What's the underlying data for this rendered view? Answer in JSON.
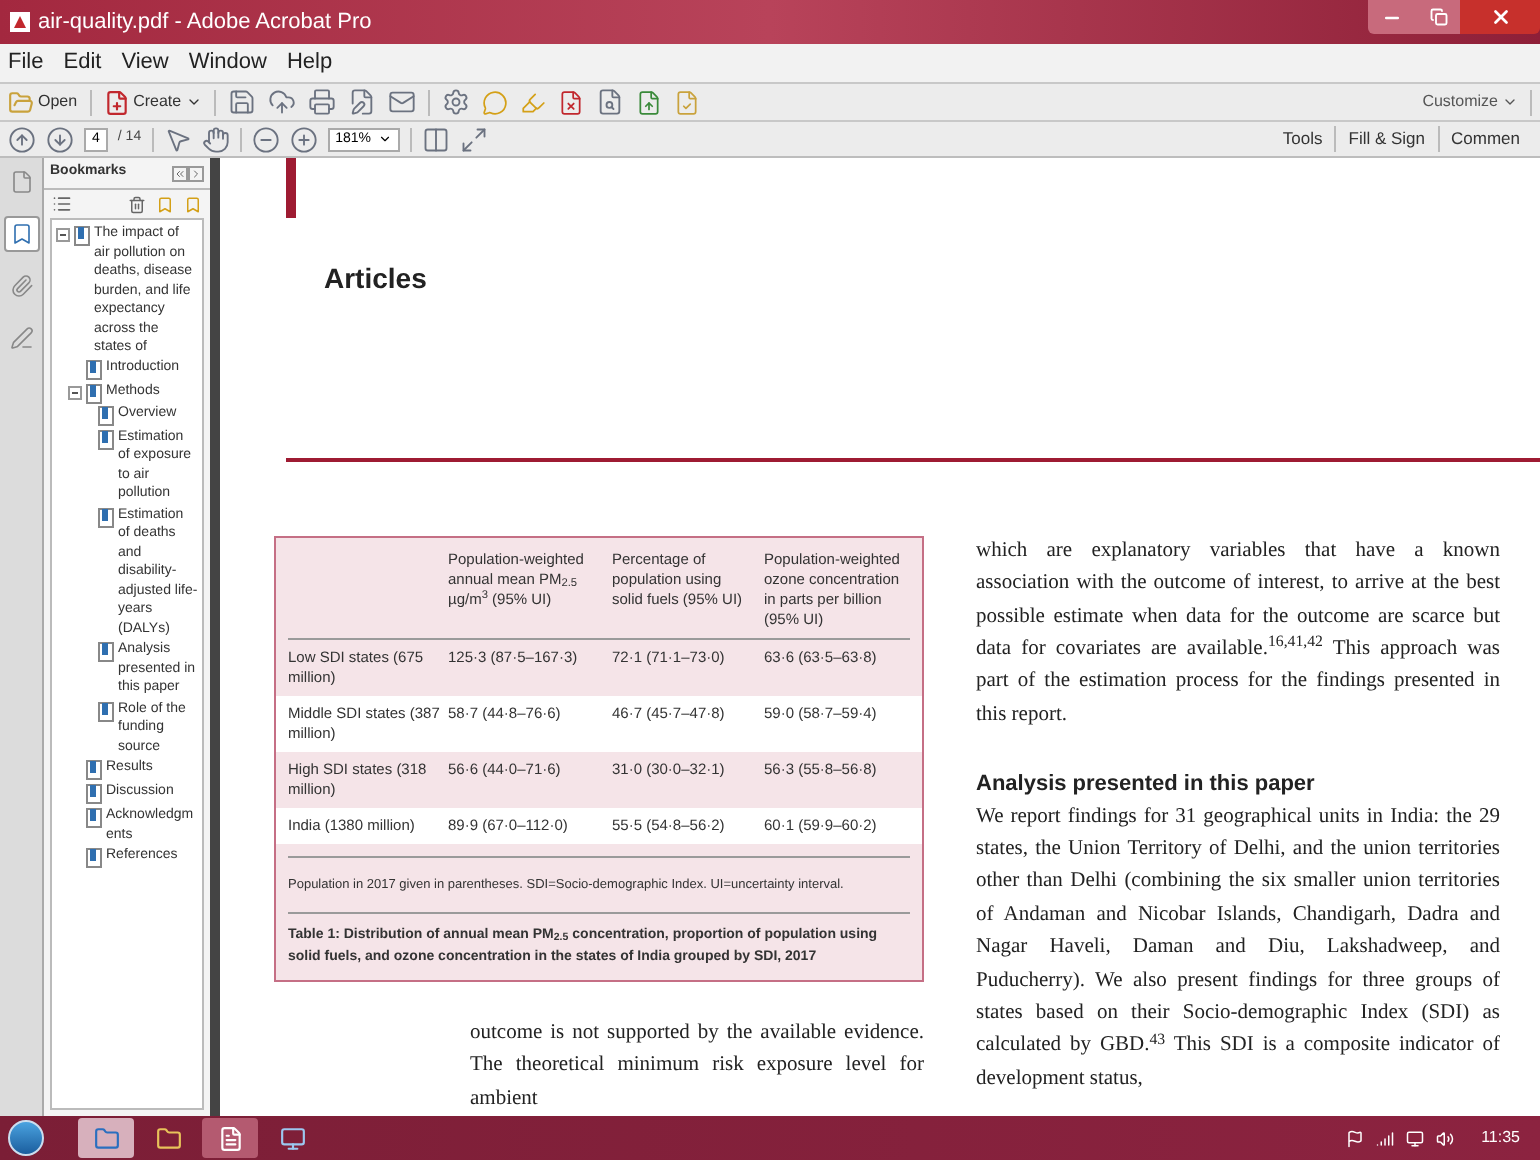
{
  "window": {
    "title": "air-quality.pdf - Adobe Acrobat Pro"
  },
  "menu": [
    "File",
    "Edit",
    "View",
    "Window",
    "Help"
  ],
  "toolbar": {
    "open": "Open",
    "create": "Create",
    "customize": "Customize"
  },
  "nav": {
    "page": "4",
    "page_count": "/ 14",
    "zoom": "181%"
  },
  "right_tabs": [
    "Tools",
    "Fill & Sign",
    "Commen"
  ],
  "side_strip": [
    {
      "kind": "pages",
      "selected": false
    },
    {
      "kind": "bookmarks",
      "selected": true
    },
    {
      "kind": "attachments",
      "selected": false
    },
    {
      "kind": "signatures",
      "selected": false
    }
  ],
  "bookmarks": {
    "title": "Bookmarks",
    "items": [
      {
        "label": "The impact of air pollution on deaths, disease burden, and life expectancy across the states of",
        "expanded": true,
        "children": [
          {
            "label": "Introduction"
          },
          {
            "label": "Methods",
            "expanded": true,
            "children": [
              {
                "label": "Overview"
              },
              {
                "label": "Estimation of exposure to air pollution"
              },
              {
                "label": "Estimation of deaths and disability-adjusted life-years (DALYs)"
              },
              {
                "label": "Analysis presented in this paper"
              },
              {
                "label": "Role of the funding source"
              }
            ]
          },
          {
            "label": "Results"
          },
          {
            "label": "Discussion"
          },
          {
            "label": "Acknowledgments"
          },
          {
            "label": "References"
          }
        ]
      }
    ]
  },
  "document": {
    "section": "Articles",
    "table": {
      "columns": [
        "",
        "Population-weighted annual mean PM$_{2.5}$ µg/m$^{3}$ (95% UI)",
        "Percentage of population using solid fuels (95% UI)",
        "Population-weighted ozone concentration in parts per billion (95% UI)"
      ],
      "rows": [
        {
          "shaded": true,
          "cells": [
            "Low SDI states (675 million)",
            "125·3 (87·5–167·3)",
            "72·1 (71·1–73·0)",
            "63·6 (63·5–63·8)"
          ]
        },
        {
          "shaded": false,
          "cells": [
            "Middle SDI states (387 million)",
            "58·7 (44·8–76·6)",
            "46·7 (45·7–47·8)",
            "59·0 (58·7–59·4)"
          ]
        },
        {
          "shaded": true,
          "cells": [
            "High SDI states (318 million)",
            "56·6 (44·0–71·6)",
            "31·0 (30·0–32·1)",
            "56·3 (55·8–56·8)"
          ]
        },
        {
          "shaded": false,
          "cells": [
            "India (1380 million)",
            "89·9 (67·0–112·0)",
            "55·5 (54·8–56·2)",
            "60·1 (59·9–60·2)"
          ]
        }
      ],
      "note": "Population in 2017 given in parentheses. SDI=Socio-demographic Index. UI=uncertainty interval.",
      "caption": "Table 1: Distribution of annual mean PM$_{2.5}$ concentration, proportion of population using solid fuels, and ozone concentration in the states of India grouped by SDI, 2017"
    },
    "left_text": "outcome is not supported by the available evidence. The theoretical minimum risk exposure level for ambient",
    "right_paragraph": "which are explanatory variables that have a known association with the outcome of interest, to arrive at the best possible estimate when data for the outcome are scarce but data for covariates are available.$^{16,41,42}$ This approach was part of the estimation process for the findings presented in this report.",
    "heading": "Analysis presented in this paper",
    "heading_paragraph": "We report findings for 31 geographical units in India: the 29 states, the Union Territory of Delhi, and the union territories other than Delhi (combining the six smaller union territories of Andaman and Nicobar Islands, Chandigarh, Dadra and Nagar Haveli, Daman and Diu, Lakshadweep, and Puducherry). We also present findings for three groups of states based on their Socio-demographic Index (SDI) as calculated by GBD.$^{43}$ This SDI is a composite indicator of development status,"
  },
  "taskbar": {
    "time": "11:35"
  }
}
